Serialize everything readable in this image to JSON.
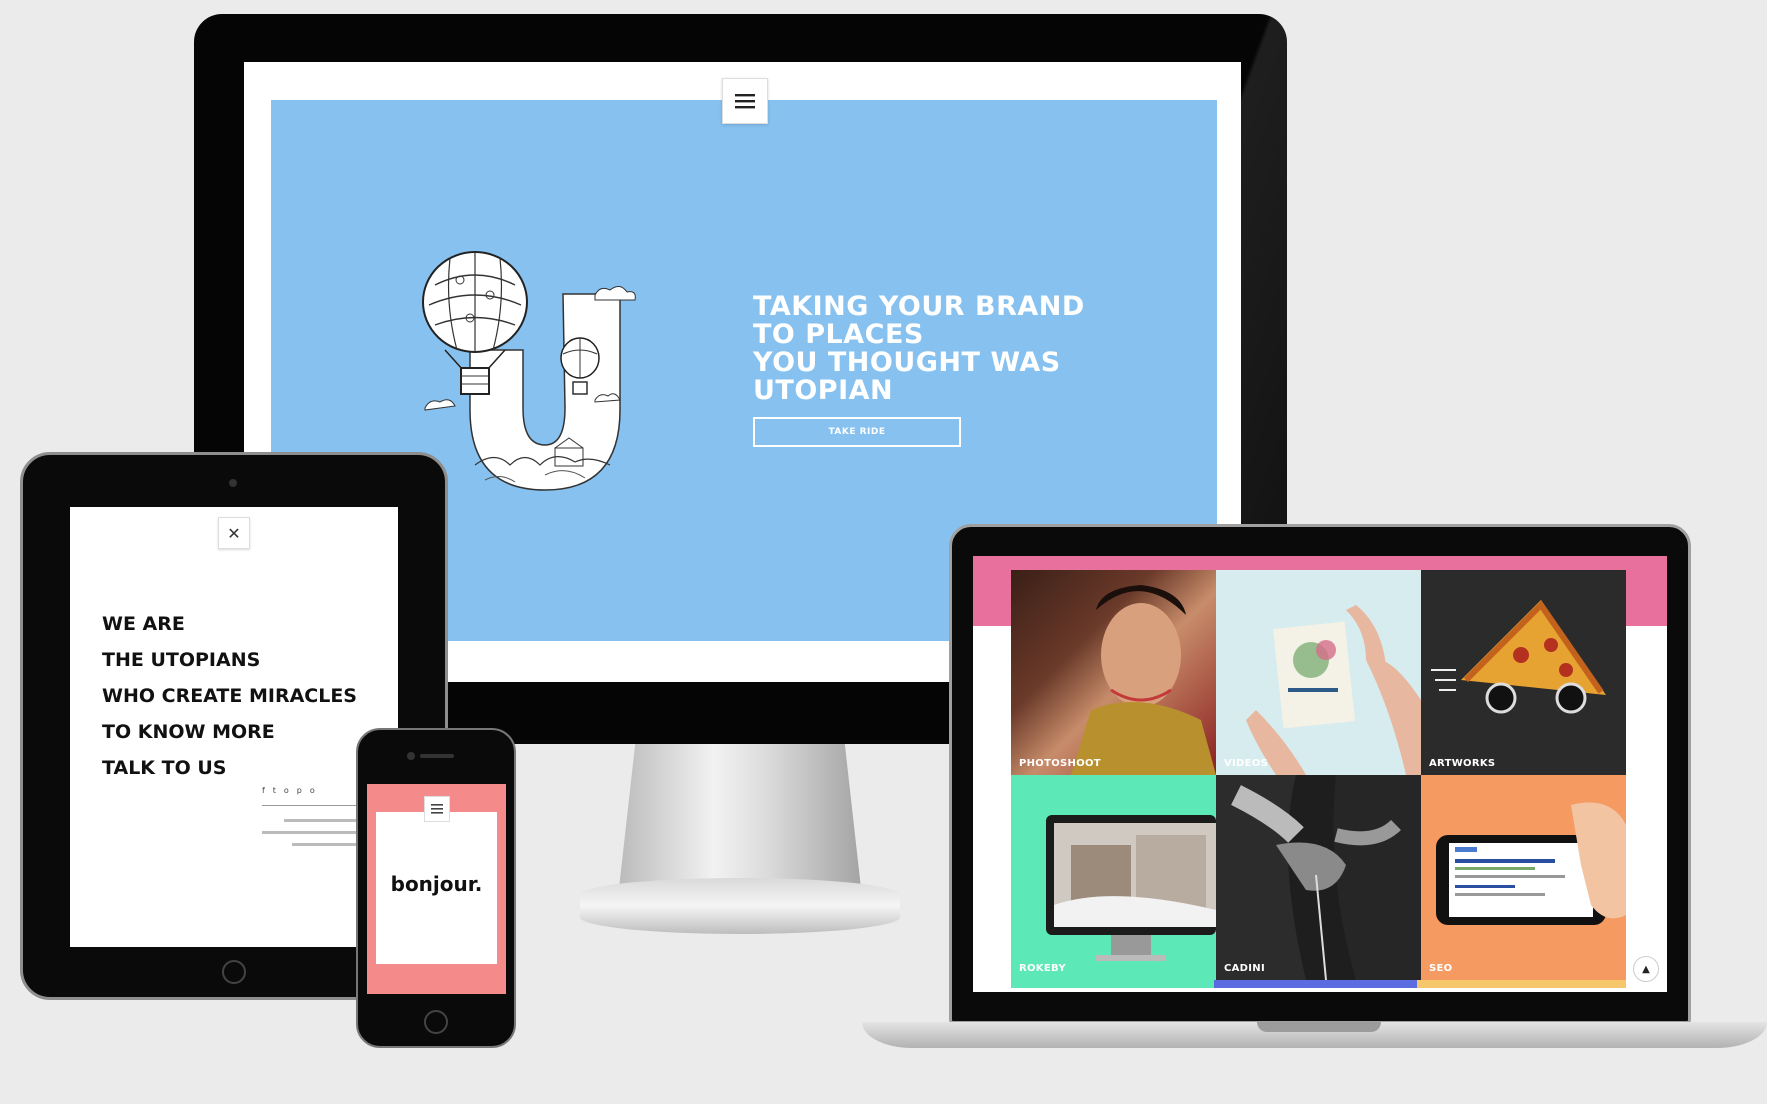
{
  "desktop": {
    "hero_lines": [
      "TAKING YOUR BRAND",
      "TO PLACES",
      "YOU THOUGHT WAS",
      "UTOPIAN"
    ],
    "cta_label": "TAKE RIDE",
    "hero_color": "#86c1ef"
  },
  "tablet": {
    "lines": [
      "WE ARE",
      "THE UTOPIANS",
      "WHO CREATE MIRACLES",
      "TO KNOW MORE",
      "TALK TO US"
    ],
    "social_icons": [
      "f",
      "t",
      "o",
      "p",
      "o"
    ]
  },
  "phone": {
    "greeting": "bonjour.",
    "accent_color": "#f48a89"
  },
  "laptop": {
    "tiles": [
      {
        "label": "PHOTOSHOOT",
        "color": "#7a2a2a"
      },
      {
        "label": "VIDEOS",
        "color": "#d6ecef"
      },
      {
        "label": "ARTWORKS",
        "color": "#2b2b2b"
      },
      {
        "label": "ROKEBY",
        "color": "#5de8b8"
      },
      {
        "label": "CADINI",
        "color": "#1e1e1e"
      },
      {
        "label": "SEO",
        "color": "#f59b62"
      }
    ],
    "header_color": "#e8709c"
  },
  "icons": [
    "hamburger-menu-icon",
    "close-icon",
    "scroll-to-top-icon",
    "balloon-u-logo"
  ]
}
